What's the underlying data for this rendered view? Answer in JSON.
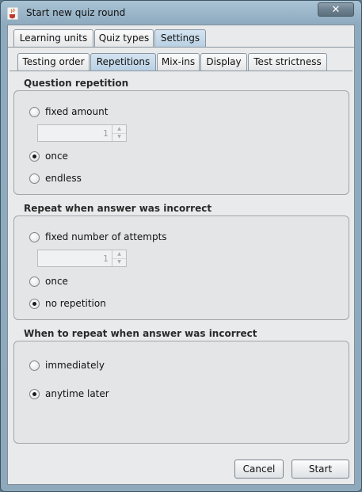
{
  "window": {
    "title": "Start new quiz round",
    "close_icon": "close-icon",
    "app_icon": "java-cup-icon"
  },
  "top_tabs": [
    "Learning units",
    "Quiz types",
    "Settings"
  ],
  "top_selected": "Settings",
  "sub_tabs": [
    "Testing order",
    "Repetitions",
    "Mix-ins",
    "Display",
    "Test strictness"
  ],
  "sub_selected": "Repetitions",
  "question_repetition": {
    "title": "Question repetition",
    "options": [
      "fixed amount",
      "once",
      "endless"
    ],
    "selected": "once",
    "spinner_value": "1"
  },
  "repeat_incorrect": {
    "title": "Repeat when answer was incorrect",
    "options": [
      "fixed number of attempts",
      "once",
      "no repetition"
    ],
    "selected": "no repetition",
    "spinner_value": "1"
  },
  "when_repeat": {
    "title": "When to repeat when answer was incorrect",
    "options": [
      "immediately",
      "anytime later"
    ],
    "selected": "anytime later"
  },
  "buttons": {
    "cancel": "Cancel",
    "start": "Start"
  },
  "colors": {
    "window_frame": "#8fa9bc",
    "selected_tab": "#b7cfe3",
    "panel": "#e9eaeb"
  }
}
